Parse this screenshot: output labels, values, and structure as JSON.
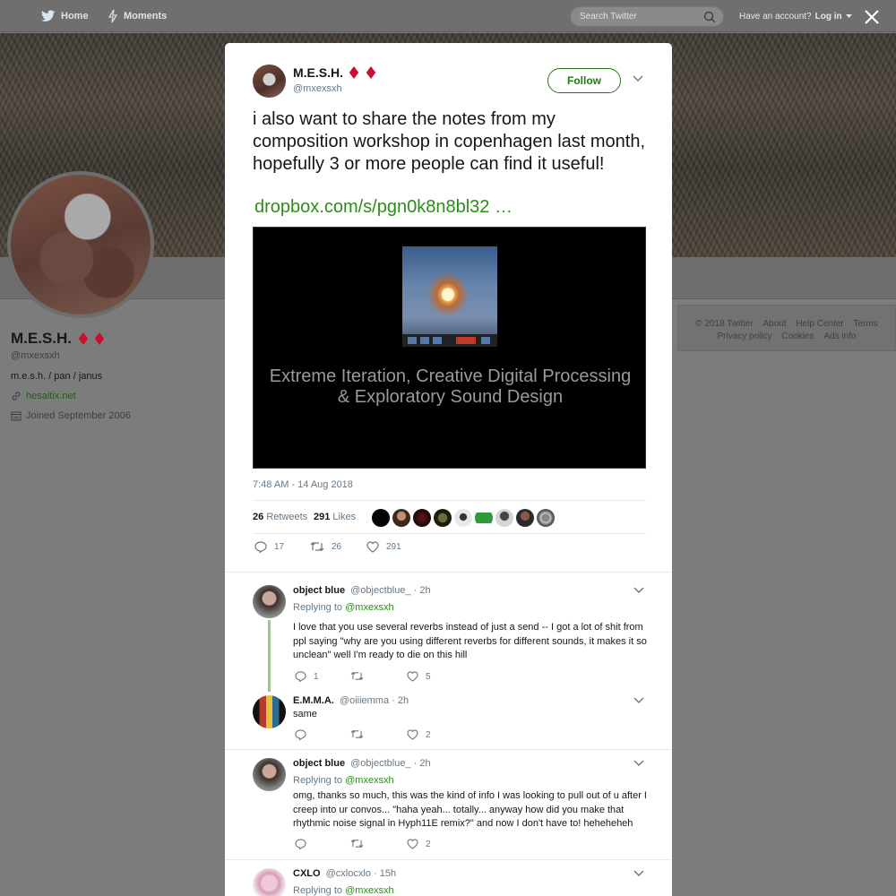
{
  "topbar": {
    "home_label": "Home",
    "moments_label": "Moments",
    "search_placeholder": "Search Twitter",
    "have_account": "Have an account?",
    "login_label": "Log in"
  },
  "profile": {
    "name": "M.E.S.H.",
    "handle": "@mxexsxh",
    "bio": "m.e.s.h. / pan / janus",
    "website": "hesaitix.net",
    "joined": "Joined September 2006"
  },
  "footer": {
    "links_row1": [
      "© 2018 Twitter",
      "About",
      "Help Center",
      "Terms"
    ],
    "links_row2": [
      "Privacy policy",
      "Cookies",
      "Ads info"
    ]
  },
  "tweet": {
    "author_name": "M.E.S.H.",
    "author_handle": "@mxexsxh",
    "follow_label": "Follow",
    "text": "i also want to share the notes from my composition workshop in copenhagen last month, hopefully 3 or more people can find it useful!",
    "link": "dropbox.com/s/pgn0k8n8bl32 …",
    "media_caption_line1": "Extreme Iteration, Creative Digital Processing",
    "media_caption_line2": "& Exploratory Sound Design",
    "timestamp": "7:48 AM - 14 Aug 2018",
    "retweets_count": "26",
    "retweets_label": "Retweets",
    "likes_count": "291",
    "likes_label": "Likes",
    "reply_count": "17",
    "retweet_count": "26",
    "like_count": "291"
  },
  "replies": [
    {
      "name": "object blue",
      "handle": "@objectblue_",
      "time": "· 2h",
      "replying_prefix": "Replying to",
      "replying_to": "@mxexsxh",
      "text": "I love that you use several reverbs instead of just a send -- I got a lot of shit from ppl saying \"why are you using different reverbs for different sounds, it makes it so unclean\" well I'm ready to die on this hill",
      "reply_count": "1",
      "retweet_count": "",
      "like_count": "5"
    },
    {
      "name": "E.M.M.A.",
      "handle": "@oiiiemma",
      "time": "· 2h",
      "text": "same",
      "reply_count": "",
      "retweet_count": "",
      "like_count": "2"
    },
    {
      "name": "object blue",
      "handle": "@objectblue_",
      "time": "· 2h",
      "replying_prefix": "Replying to",
      "replying_to": "@mxexsxh",
      "text": "omg, thanks so much, this was the kind of info I was looking to pull out of u after I creep into ur convos... \"haha yeah... totally... anyway how did you make that rhythmic noise signal in Hyph11E remix?\" and now I don't have to! heheheheh",
      "reply_count": "",
      "retweet_count": "",
      "like_count": "2"
    },
    {
      "name": "CXLO",
      "handle": "@cxlocxlo",
      "time": "· 15h",
      "replying_prefix": "Replying to",
      "replying_to": "@mxexsxh"
    }
  ],
  "colors": {
    "accent_green": "#2a8f18",
    "follow_green": "#1f7a0e",
    "thread_line": "#8ed07c",
    "diamond_red": "#c8102e"
  },
  "icons": [
    "twitter-bird-icon",
    "lightning-icon",
    "search-icon",
    "close-icon",
    "link-icon",
    "calendar-icon",
    "chevron-down-icon",
    "reply-icon",
    "retweet-icon",
    "heart-icon",
    "diamond-icon"
  ]
}
